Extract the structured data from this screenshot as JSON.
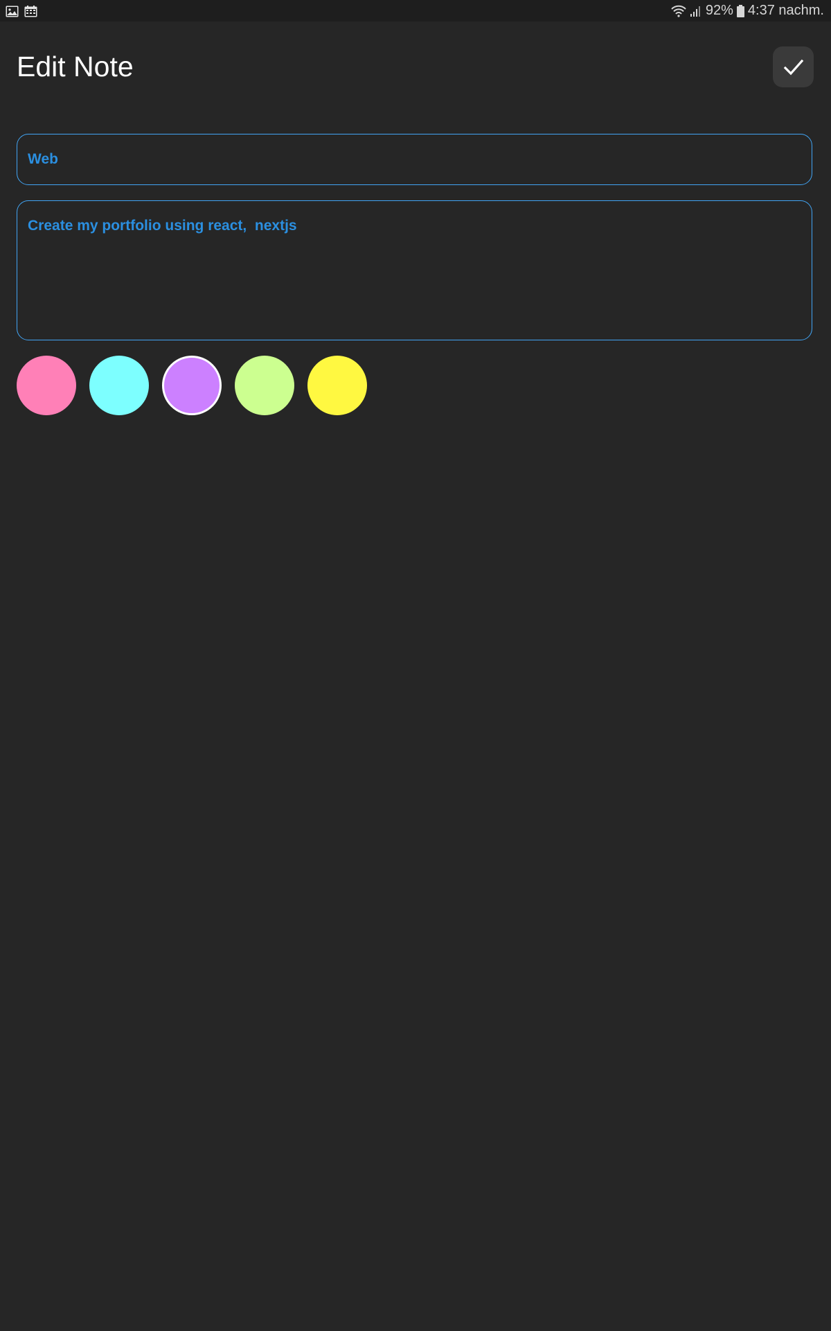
{
  "status_bar": {
    "left_icons": [
      "image-icon",
      "calendar-icon"
    ],
    "battery_percent": "92%",
    "time": "4:37 nachm."
  },
  "header": {
    "title": "Edit Note",
    "save_icon": "check-icon"
  },
  "form": {
    "title_value": "Web",
    "content_value": "Create my portfolio using react,  nextjs"
  },
  "colors": {
    "options": [
      "#ff80b7",
      "#7dffff",
      "#cc80ff",
      "#ccff90",
      "#fff841"
    ],
    "selected_index": 2
  },
  "theme": {
    "background": "#262626",
    "status_bar": "#1e1e1e",
    "accent": "#42a5f5",
    "input_text": "#2b8fe0",
    "button_bg": "#3a3a3a"
  }
}
